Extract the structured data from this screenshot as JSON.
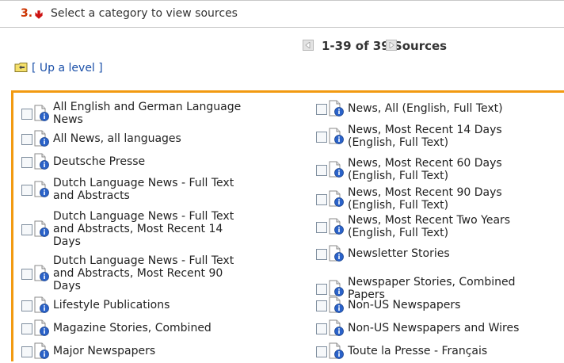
{
  "step": {
    "number": "3.",
    "instruction": "Select a category to view sources"
  },
  "pager": {
    "summary": "1-39 of 39 Sources",
    "prev_icon": "arrow-left-icon",
    "next_icon": "arrow-right-icon"
  },
  "navigation": {
    "up_level_label": "[ Up a level ]",
    "up_level_icon": "folder-up-icon"
  },
  "colors": {
    "panel_border": "#f29a11",
    "link": "#1a4fa8",
    "step_number": "#cc3300"
  },
  "sources": {
    "left": [
      {
        "label": "All English and German Language\nNews",
        "checked": false
      },
      {
        "label": "All News, all languages",
        "checked": false
      },
      {
        "label": "Deutsche Presse",
        "checked": false
      },
      {
        "label": "Dutch Language News - Full Text\nand Abstracts",
        "checked": false
      },
      {
        "label": "Dutch Language News - Full Text\nand Abstracts, Most Recent 14\nDays",
        "checked": false
      },
      {
        "label": "Dutch Language News - Full Text\nand Abstracts, Most Recent 90\nDays",
        "checked": false
      },
      {
        "label": "Lifestyle Publications",
        "checked": false
      },
      {
        "label": "Magazine Stories, Combined",
        "checked": false
      },
      {
        "label": "Major Newspapers",
        "checked": false
      }
    ],
    "right": [
      {
        "label": "News, All (English, Full Text)",
        "checked": false
      },
      {
        "label": "News, Most Recent 14 Days\n(English, Full Text)",
        "checked": false
      },
      {
        "label": "News, Most Recent 60 Days\n(English, Full Text)",
        "checked": false
      },
      {
        "label": "News, Most Recent 90 Days\n(English, Full Text)",
        "checked": false
      },
      {
        "label": "News, Most Recent Two Years\n(English, Full Text)",
        "checked": false
      },
      {
        "label": "Newsletter Stories",
        "checked": false
      },
      {
        "label": "Newspaper Stories, Combined\nPapers",
        "checked": false
      },
      {
        "label": "Non-US Newspapers",
        "checked": false
      },
      {
        "label": "Non-US Newspapers and Wires",
        "checked": false
      },
      {
        "label": "Toute la Presse - Français",
        "checked": false
      }
    ]
  }
}
